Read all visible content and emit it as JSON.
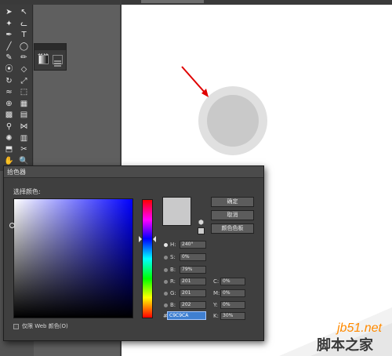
{
  "canvas": {
    "outer_circle_color": "#e0e0e0",
    "inner_circle_color": "#c9c9c9",
    "annotation_arrow_color": "#e00000"
  },
  "tool_icons": [
    "selection-tool",
    "direct-selection-tool",
    "magic-wand-tool",
    "lasso-tool",
    "pen-tool",
    "type-tool",
    "line-tool",
    "ellipse-tool",
    "paintbrush-tool",
    "pencil-tool",
    "blob-brush-tool",
    "eraser-tool",
    "rotate-tool",
    "scale-tool",
    "warp-tool",
    "free-transform-tool",
    "shape-builder-tool",
    "perspective-grid-tool",
    "mesh-tool",
    "gradient-tool",
    "eyedropper-tool",
    "blend-tool",
    "symbol-sprayer-tool",
    "column-graph-tool",
    "artboard-tool",
    "slice-tool",
    "hand-tool",
    "zoom-tool"
  ],
  "dialog": {
    "title": "拾色器",
    "select_color_label": "选择颜色:",
    "buttons": {
      "ok": "确定",
      "cancel": "取消",
      "swatches": "颜色色板"
    },
    "current_color": "#c9c9ca",
    "hsb": {
      "h_label": "H:",
      "h_value": "240°",
      "s_label": "S:",
      "s_value": "0%",
      "b_label": "B:",
      "b_value": "79%"
    },
    "rgb": {
      "r_label": "R:",
      "r_value": "201",
      "g_label": "G:",
      "g_value": "201",
      "b_label": "B:",
      "b_value": "202"
    },
    "cmyk": {
      "c_label": "C:",
      "c_value": "0%",
      "m_label": "M:",
      "m_value": "0%",
      "y_label": "Y:",
      "y_value": "0%",
      "k_label": "K:",
      "k_value": "30%"
    },
    "hex_prefix": "#",
    "hex_value": "C9C9CA",
    "web_only_label": "仅限 Web 颜色(O)"
  },
  "watermark": {
    "site": "jb51.net",
    "name": "脚本之家"
  }
}
